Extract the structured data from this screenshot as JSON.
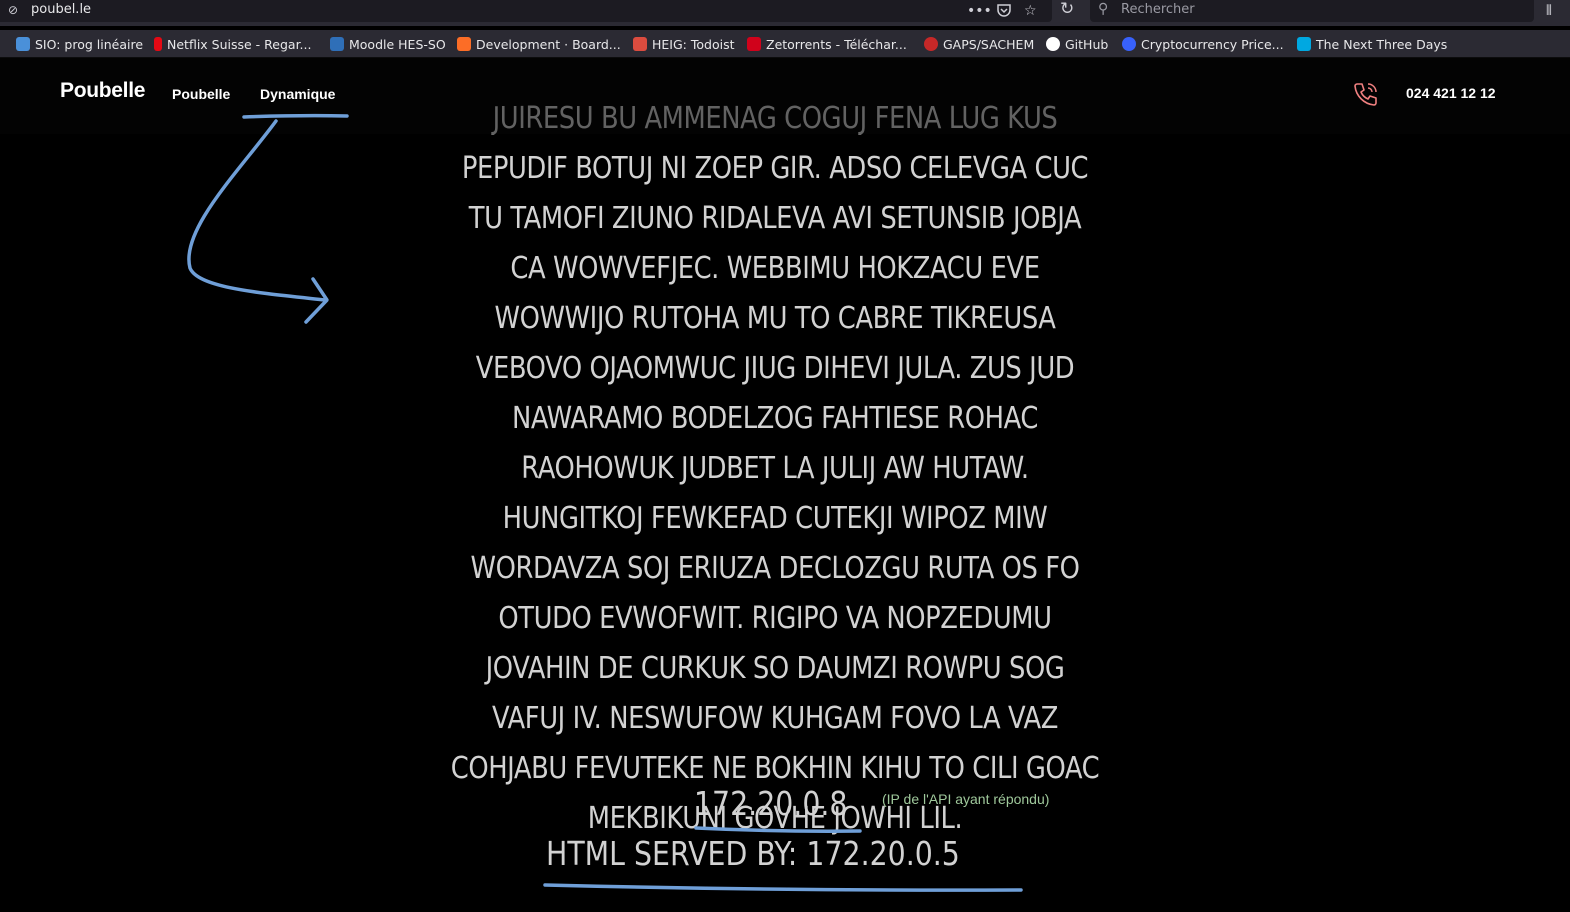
{
  "browser": {
    "url": "poubel.le",
    "search_placeholder": "Rechercher",
    "bookmarks": [
      {
        "label": "SIO: prog linéaire",
        "color": "#4a90d9"
      },
      {
        "label": "Netflix Suisse - Regar...",
        "color": "#e50914"
      },
      {
        "label": "Moodle HES-SO",
        "color": "#2f6fb8"
      },
      {
        "label": "Development · Board...",
        "color": "#fc6d26"
      },
      {
        "label": "HEIG: Todoist",
        "color": "#db4c3f"
      },
      {
        "label": "Zetorrents - Téléchar...",
        "color": "#d0021b"
      },
      {
        "label": "GAPS/SACHEM",
        "color": "#c62828"
      },
      {
        "label": "GitHub",
        "color": "#ffffff"
      },
      {
        "label": "Cryptocurrency Price...",
        "color": "#3861fb"
      },
      {
        "label": "The Next Three Days",
        "color": "#00a8e1"
      }
    ]
  },
  "site": {
    "brand": "Poubelle",
    "nav": [
      {
        "label": "Poubelle"
      },
      {
        "label": "Dynamique"
      }
    ],
    "phone": "024 421 12 12"
  },
  "content": {
    "lines": [
      "JUIRESU BU AMMENAG COGUJ FENA LUG KUS",
      "PEPUDIF BOTUJ NI ZOEP GIR. ADSO CELEVGA CUC",
      "TU TAMOFI ZIUNO RIDALEVA AVI SETUNSIB JOBJA",
      "CA WOWVEFJEC. WEBBIMU HOKZACU EVE",
      "WOWWIJO RUTOHA MU TO CABRE TIKREUSA",
      "VEBOVO OJAOMWUC JIUG DIHEVI JULA. ZUS JUD",
      "NAWARAMO BODELZOG FAHTIESE ROHAC",
      "RAOHOWUK JUDBET LA JULIJ AW HUTAW.",
      "HUNGITKOJ FEWKEFAD CUTEKJI WIPOZ MIW",
      "WORDAVZA SOJ ERIUZA DECLOZGU RUTA OS FO",
      "OTUDO EVWOFWIT. RIGIPO VA NOPZEDUMU",
      "JOVAHIN DE CURKUK SO DAUMZI ROWPU SOG",
      "VAFUJ IV. NESWUFOW KUHGAM FOVO LA VAZ",
      "COHJABU FEVUTEKE NE BOKHIN KIHU TO CILI GOAC",
      "MEKBIKUNI GOVHE JOWHI LIL."
    ],
    "api_ip": "172.20.0.8",
    "api_note": "(IP de l'API ayant répondu)",
    "served_by": "HTML SERVED BY: 172.20.0.5"
  },
  "colors": {
    "annotation": "#6f9fd8",
    "note": "#9fc89b",
    "text": "#d2d2d2"
  }
}
